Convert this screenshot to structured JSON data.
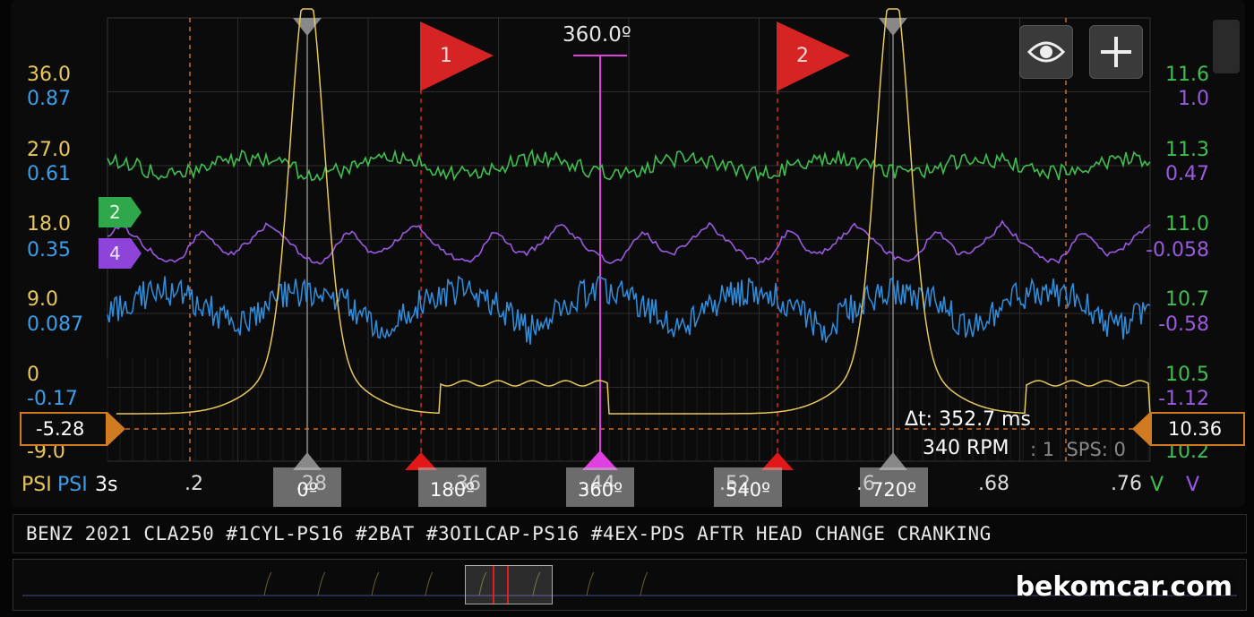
{
  "left_axis": {
    "psi": [
      "36.0",
      "27.0",
      "18.0",
      "9.0",
      "0",
      "-9.0"
    ],
    "blue": [
      "0.87",
      "0.61",
      "0.35",
      "0.087",
      "-0.17"
    ],
    "colors": {
      "psi": "#e8c85a",
      "blue": "#3b9ee8"
    }
  },
  "right_axis": {
    "green": [
      "11.6",
      "11.3",
      "11.0",
      "10.7",
      "10.5",
      "10.2"
    ],
    "purple": [
      "1.0",
      "0.47",
      "-0.058",
      "-0.58",
      "-1.12"
    ],
    "colors": {
      "green": "#3fbf4f",
      "purple": "#9b59e0"
    }
  },
  "cursor_left_value": "-5.28",
  "cursor_right_value": "10.36",
  "center_cursor_label": "360.0º",
  "flags": [
    {
      "label": "1"
    },
    {
      "label": "2"
    }
  ],
  "channel_markers": [
    {
      "label": "2",
      "color": "#2ea84a"
    },
    {
      "label": "4",
      "color": "#8e44d9"
    }
  ],
  "measurements": {
    "delta_t": "Δt: 352.7 ms",
    "rpm": "340 RPM",
    "sps": ": 1  SPS: 0"
  },
  "time_axis": {
    "ticks": [
      ".2",
      ".28",
      ".36",
      ".44",
      ".52",
      ".6",
      ".68",
      ".76"
    ],
    "unit_left": "PSI",
    "unit_left2": "PSI",
    "unit_time": "3s",
    "unit_v1": "V",
    "unit_v2": "V"
  },
  "degree_labels": [
    "0º",
    "180º",
    "360º",
    "540º",
    "720º"
  ],
  "buttons": {
    "view_icon": "eye-icon",
    "add_icon": "plus-icon"
  },
  "description": "BENZ 2021 CLA250 #1CYL-PS16 #2BAT #3OILCAP-PS16 #4EX-PDS AFTR HEAD CHANGE CRANKING",
  "watermark": "bekomcar.com"
}
